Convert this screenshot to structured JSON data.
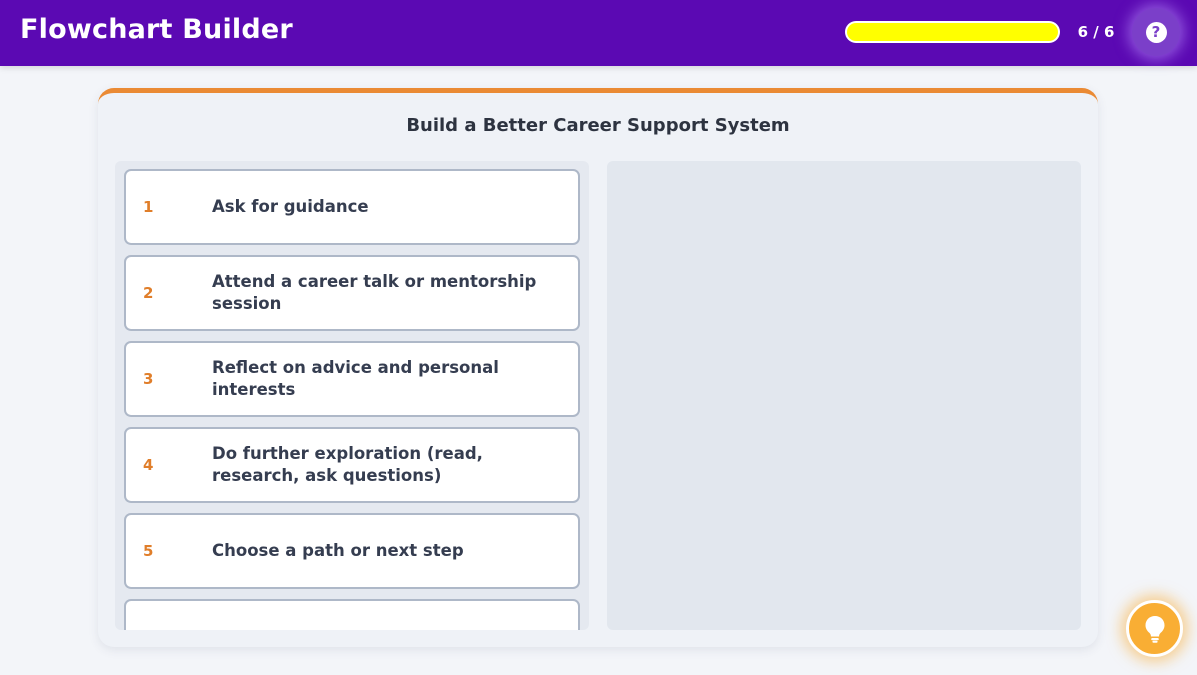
{
  "header": {
    "title": "Flowchart Builder",
    "progress_text": "6 / 6",
    "progress_fraction": 1.0,
    "help_icon": "question-circle-icon",
    "colors": {
      "bar": "#5b09b3",
      "progress_fill": "#ffff00"
    }
  },
  "card": {
    "title": "Build a Better Career Support System",
    "accent_color": "#ea8a34"
  },
  "steps": [
    {
      "num": "1",
      "text": "Ask for guidance"
    },
    {
      "num": "2",
      "text": "Attend a career talk or mentorship session"
    },
    {
      "num": "3",
      "text": "Reflect on advice and personal interests"
    },
    {
      "num": "4",
      "text": "Do further exploration (read, research, ask questions)"
    },
    {
      "num": "5",
      "text": "Choose a path or next step"
    },
    {
      "num": "",
      "text": ""
    }
  ],
  "hint": {
    "icon": "lightbulb-icon",
    "color": "#f9ae34"
  }
}
